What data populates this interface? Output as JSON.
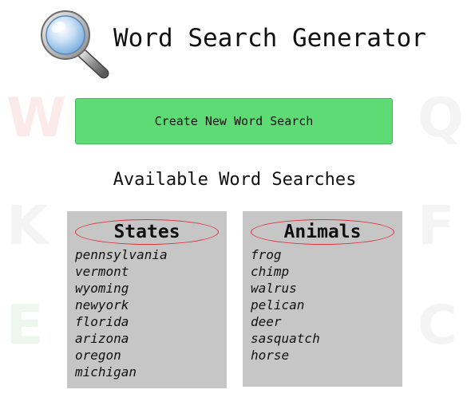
{
  "header": {
    "title": "Word Search Generator",
    "logo_icon": "magnifying-glass-icon"
  },
  "create_button": {
    "label": "Create New Word Search",
    "color": "#5fdb75"
  },
  "section": {
    "title": "Available Word Searches"
  },
  "word_searches": [
    {
      "name": "States",
      "words": [
        "pennsylvania",
        "vermont",
        "wyoming",
        "newyork",
        "florida",
        "arizona",
        "oregon",
        "michigan"
      ]
    },
    {
      "name": "Animals",
      "words": [
        "frog",
        "chimp",
        "walrus",
        "pelican",
        "deer",
        "sasquatch",
        "horse"
      ]
    }
  ],
  "background_letters": [
    "W",
    "Q",
    "K",
    "F",
    "E",
    "C"
  ]
}
